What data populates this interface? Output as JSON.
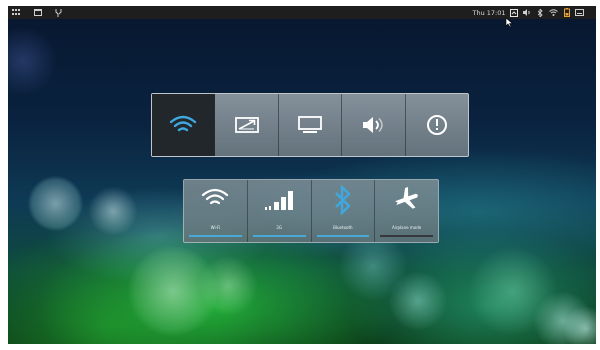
{
  "topbar": {
    "clock": "Thu 17:01",
    "left_icons": [
      "apps-grid-icon",
      "window-icon",
      "settings-icon"
    ],
    "right_icons": [
      "display-icon",
      "volume-icon",
      "bluetooth-icon",
      "wifi-icon",
      "battery-icon",
      "keyboard-icon"
    ]
  },
  "quick_settings": {
    "buttons": [
      {
        "icon": "wifi-icon",
        "active": true
      },
      {
        "icon": "display-brightness-icon",
        "active": false
      },
      {
        "icon": "monitor-icon",
        "active": false
      },
      {
        "icon": "volume-icon",
        "active": false
      },
      {
        "icon": "power-icon",
        "active": false
      }
    ]
  },
  "connectivity": {
    "tiles": [
      {
        "label": "Wi-Fi",
        "icon": "wifi-icon",
        "enabled": true
      },
      {
        "label": "3G",
        "icon": "cellular-signal-icon",
        "enabled": true
      },
      {
        "label": "Bluetooth",
        "icon": "bluetooth-icon",
        "enabled": true
      },
      {
        "label": "Airplane mode",
        "icon": "airplane-icon",
        "enabled": false
      }
    ]
  },
  "colors": {
    "accent": "#48a8d6",
    "active_button": "#22272b",
    "topbar": "#1e1e1e"
  }
}
